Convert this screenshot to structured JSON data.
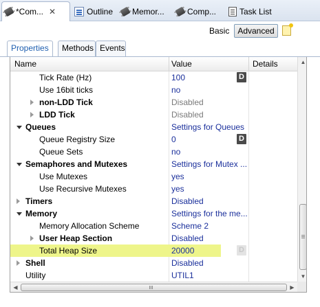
{
  "view_tabs": [
    {
      "label": "*Com...",
      "icon": "chip-icon",
      "active": true,
      "closable": true
    },
    {
      "label": "Outline",
      "icon": "outline-icon"
    },
    {
      "label": "Memor...",
      "icon": "chip-icon"
    },
    {
      "label": "Comp...",
      "icon": "chip-icon"
    },
    {
      "label": "Task List",
      "icon": "task-list-icon"
    }
  ],
  "mode": {
    "basic": "Basic",
    "advanced": "Advanced"
  },
  "sub_tabs": [
    "Properties",
    "Methods",
    "Events"
  ],
  "columns": {
    "name": "Name",
    "value": "Value",
    "details": "Details"
  },
  "rows": [
    {
      "name": "Tick Rate (Hz)",
      "value": "100",
      "indent": 2,
      "bold": false,
      "twisty": "none",
      "value_style": "normal",
      "d_button": "dark"
    },
    {
      "name": "Use 16bit ticks",
      "value": "no",
      "indent": 2,
      "bold": false,
      "twisty": "none",
      "value_style": "normal",
      "d_button": "none"
    },
    {
      "name": "non-LDD Tick",
      "value": "Disabled",
      "indent": 2,
      "bold": true,
      "twisty": "closed",
      "value_style": "disabled",
      "d_button": "none"
    },
    {
      "name": "LDD Tick",
      "value": "Disabled",
      "indent": 2,
      "bold": true,
      "twisty": "closed",
      "value_style": "disabled",
      "d_button": "none"
    },
    {
      "name": "Queues",
      "value": "Settings for Queues",
      "indent": 1,
      "bold": true,
      "twisty": "open",
      "value_style": "normal",
      "d_button": "none"
    },
    {
      "name": "Queue Registry Size",
      "value": "0",
      "indent": 2,
      "bold": false,
      "twisty": "none",
      "value_style": "normal",
      "d_button": "dark"
    },
    {
      "name": "Queue Sets",
      "value": "no",
      "indent": 2,
      "bold": false,
      "twisty": "none",
      "value_style": "normal",
      "d_button": "none"
    },
    {
      "name": "Semaphores and Mutexes",
      "value": "Settings for Mutex ...",
      "indent": 1,
      "bold": true,
      "twisty": "open",
      "value_style": "normal",
      "d_button": "none"
    },
    {
      "name": "Use Mutexes",
      "value": "yes",
      "indent": 2,
      "bold": false,
      "twisty": "none",
      "value_style": "normal",
      "d_button": "none"
    },
    {
      "name": "Use Recursive Mutexes",
      "value": "yes",
      "indent": 2,
      "bold": false,
      "twisty": "none",
      "value_style": "normal",
      "d_button": "none"
    },
    {
      "name": "Timers",
      "value": "Disabled",
      "indent": 1,
      "bold": true,
      "twisty": "closed",
      "value_style": "normal",
      "d_button": "none"
    },
    {
      "name": "Memory",
      "value": "Settings for the me...",
      "indent": 1,
      "bold": true,
      "twisty": "open",
      "value_style": "normal",
      "d_button": "none"
    },
    {
      "name": "Memory Allocation Scheme",
      "value": "Scheme 2",
      "indent": 2,
      "bold": false,
      "twisty": "none",
      "value_style": "normal",
      "d_button": "none"
    },
    {
      "name": "User Heap Section",
      "value": "Disabled",
      "indent": 2,
      "bold": true,
      "twisty": "closed",
      "value_style": "normal",
      "d_button": "none"
    },
    {
      "name": "Total Heap Size",
      "value": "20000",
      "indent": 2,
      "bold": false,
      "twisty": "none",
      "value_style": "normal",
      "d_button": "faded",
      "highlighted": true
    },
    {
      "name": "Shell",
      "value": "Disabled",
      "indent": 1,
      "bold": true,
      "twisty": "closed",
      "value_style": "normal",
      "d_button": "none"
    },
    {
      "name": "Utility",
      "value": "UTIL1",
      "indent": 1,
      "bold": false,
      "twisty": "none",
      "value_style": "normal",
      "d_button": "none"
    }
  ],
  "d_label": "D",
  "colors": {
    "value_text": "#1a2f9b",
    "disabled_text": "#7a7a7a",
    "highlight": "#eef58a",
    "active_subtab": "#1f5fb0"
  }
}
